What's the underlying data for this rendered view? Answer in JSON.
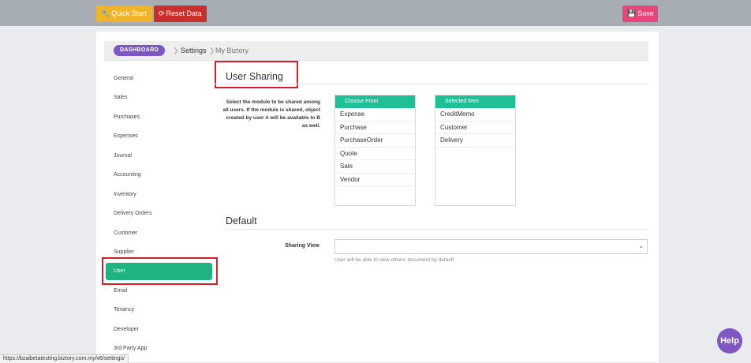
{
  "toolbar": {
    "quick_start_label": "Quick Start",
    "reset_data_label": "Reset Data",
    "save_label": "Save"
  },
  "breadcrumb": {
    "dashboard": "DASHBOARD",
    "settings": "Settings",
    "current": "My Biztory"
  },
  "sidebar": {
    "items": [
      {
        "label": "General"
      },
      {
        "label": "Sales"
      },
      {
        "label": "Purchases"
      },
      {
        "label": "Expenses"
      },
      {
        "label": "Journal"
      },
      {
        "label": "Accounting"
      },
      {
        "label": "Inventory"
      },
      {
        "label": "Delivery Orders"
      },
      {
        "label": "Customer"
      },
      {
        "label": "Supplier"
      },
      {
        "label": "User",
        "active": true
      },
      {
        "label": "Email"
      },
      {
        "label": "Tenancy"
      },
      {
        "label": "Developer"
      },
      {
        "label": "3rd Party App"
      }
    ]
  },
  "user_sharing": {
    "title": "User Sharing",
    "description": "Select the module to be shared among all users. If the module is shared, object created by user A will be available to B as well.",
    "choose_from": {
      "header": "Choose From",
      "items": [
        "Expense",
        "Purchase",
        "PurchaseOrder",
        "Quote",
        "Sale",
        "Vendor"
      ]
    },
    "selected": {
      "header": "Selected Item",
      "items": [
        "CreditMemo",
        "Customer",
        "Delivery"
      ]
    }
  },
  "default_section": {
    "title": "Default",
    "sharing_view_label": "Sharing View",
    "sharing_view_value": "",
    "help": "User will be able to view others' document by default"
  },
  "help_button": "Help",
  "status_url": "https://bzaibetatesting.biztory.com.my/v6/settings/",
  "colors": {
    "accent_green": "#1fb282",
    "list_header_teal": "#1fbf98",
    "purple": "#7e57c2",
    "highlight_red": "#d21f2b"
  }
}
